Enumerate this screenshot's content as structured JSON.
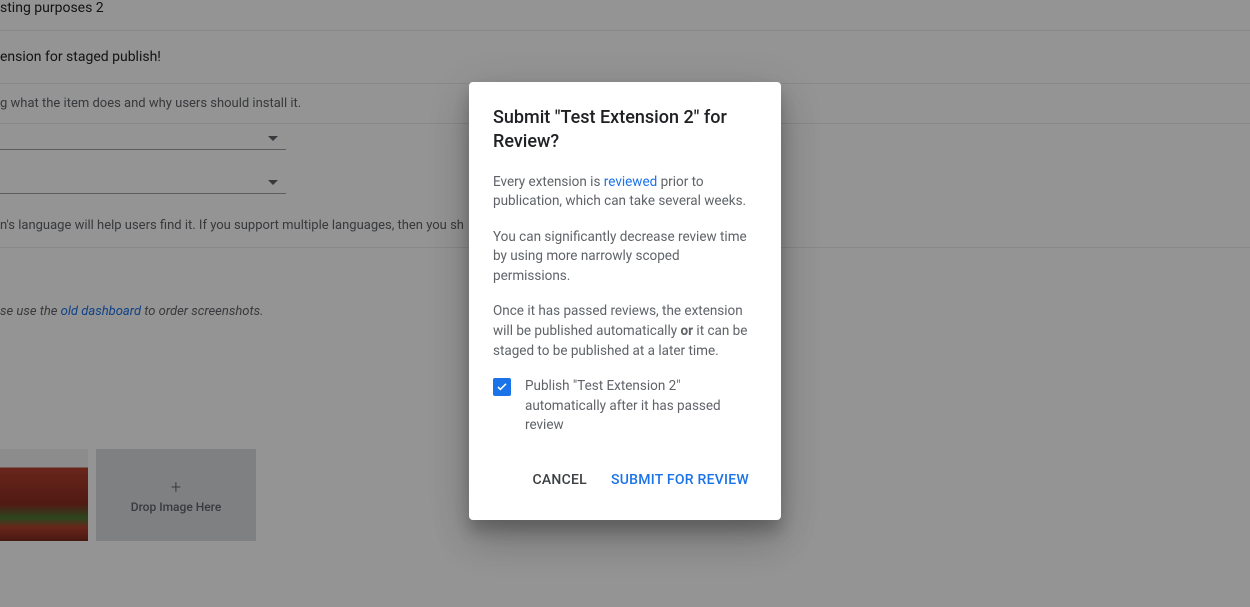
{
  "background": {
    "item_name_partial": "sting purposes 2",
    "heading_partial": "ension for staged publish!",
    "description_partial": "g what the item does and why users should install it.",
    "language_helper_partial": "n's language will help users find it. If you support multiple languages, then you sh",
    "screenshot_helper_prefix": "se use the ",
    "screenshot_helper_link": "old dashboard",
    "screenshot_helper_suffix": " to order screenshots.",
    "drop_label": "Drop Image Here"
  },
  "dialog": {
    "title": "Submit \"Test Extension 2\" for Review?",
    "p1_prefix": "Every extension is ",
    "p1_link": "reviewed",
    "p1_suffix": " prior to publication, which can take several weeks.",
    "p2": "You can significantly decrease review time by using more narrowly scoped permissions.",
    "p3_prefix": "Once it has passed reviews, the extension will be published automatically ",
    "p3_bold": "or",
    "p3_suffix": " it can be staged to be published at a later time.",
    "checkbox_label": "Publish \"Test Extension 2\" automatically after it has passed review",
    "cancel": "CANCEL",
    "submit": "SUBMIT FOR REVIEW"
  }
}
